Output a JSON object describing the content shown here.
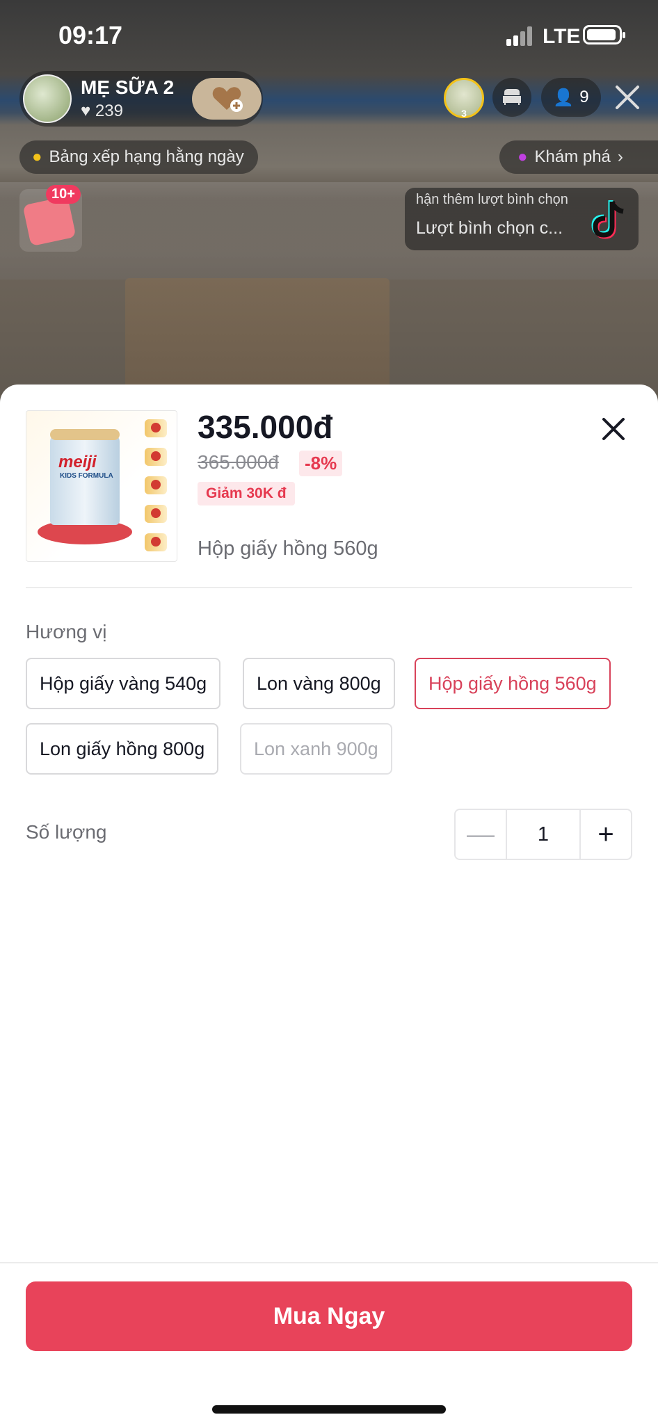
{
  "status_bar": {
    "time": "09:17",
    "network": "LTE"
  },
  "live": {
    "host_name": "MẸ SỮA 2",
    "host_likes": "239",
    "viewer_rank": "3",
    "viewer_count": "9",
    "daily_ranking_label": "Bảng xếp hạng hằng ngày",
    "explore_label": "Khám phá",
    "gift_badge": "10+",
    "vote_top_text": "hận thêm lượt bình chọn",
    "vote_bottom_text": "Lượt bình chọn c..."
  },
  "product": {
    "price_now": "335.000đ",
    "price_old": "365.000đ",
    "discount": "-8%",
    "coupon": "Giảm 30K đ",
    "selected_variant": "Hộp giấy hồng 560g",
    "image_brand": "meiji",
    "image_sub": "KIDS FORMULA"
  },
  "flavor": {
    "label": "Hương vị",
    "options": [
      {
        "label": "Hộp giấy vàng 540g",
        "state": "normal"
      },
      {
        "label": "Lon vàng 800g",
        "state": "normal"
      },
      {
        "label": "Hộp giấy hồng 560g",
        "state": "selected"
      },
      {
        "label": "Lon giấy hồng 800g",
        "state": "normal"
      },
      {
        "label": "Lon xanh 900g",
        "state": "disabled"
      }
    ]
  },
  "quantity": {
    "label": "Số lượng",
    "value": "1",
    "minus": "—",
    "plus": "+"
  },
  "footer": {
    "buy_label": "Mua Ngay"
  },
  "colors": {
    "accent": "#e8435a",
    "selected_border": "#d8425a",
    "discount_bg": "#fde8eb"
  }
}
